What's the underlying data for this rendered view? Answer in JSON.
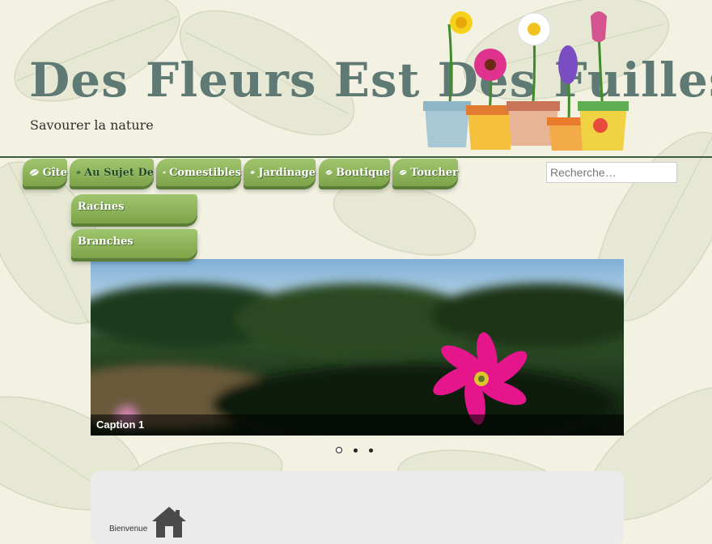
{
  "site": {
    "title": "Des Fleurs Est Des Fuilles",
    "tagline": "Savourer la nature"
  },
  "nav": {
    "items": [
      {
        "label": "Gîte",
        "icon": "leaf-icon"
      },
      {
        "label": "Au Sujet De",
        "icon": "leaf-icon",
        "active": true
      },
      {
        "label": "Comestibles",
        "icon": "leaf-icon"
      },
      {
        "label": "Jardinage",
        "icon": "leaf-icon"
      },
      {
        "label": "Boutique",
        "icon": "leaf-icon"
      },
      {
        "label": "Toucher",
        "icon": "leaf-icon"
      }
    ],
    "submenu": [
      {
        "label": "Racines"
      },
      {
        "label": "Branches"
      }
    ]
  },
  "search": {
    "placeholder": "Recherche…"
  },
  "slider": {
    "caption": "Caption 1",
    "dots_count": 3,
    "active_dot": 1
  },
  "content": {
    "welcome_text": "Bienvenue",
    "icon": "home-icon"
  },
  "colors": {
    "menu_green": "#8fb65c",
    "title_color": "#5f7a74",
    "header_line": "#3e5b3e",
    "background": "#f3f2e2"
  }
}
